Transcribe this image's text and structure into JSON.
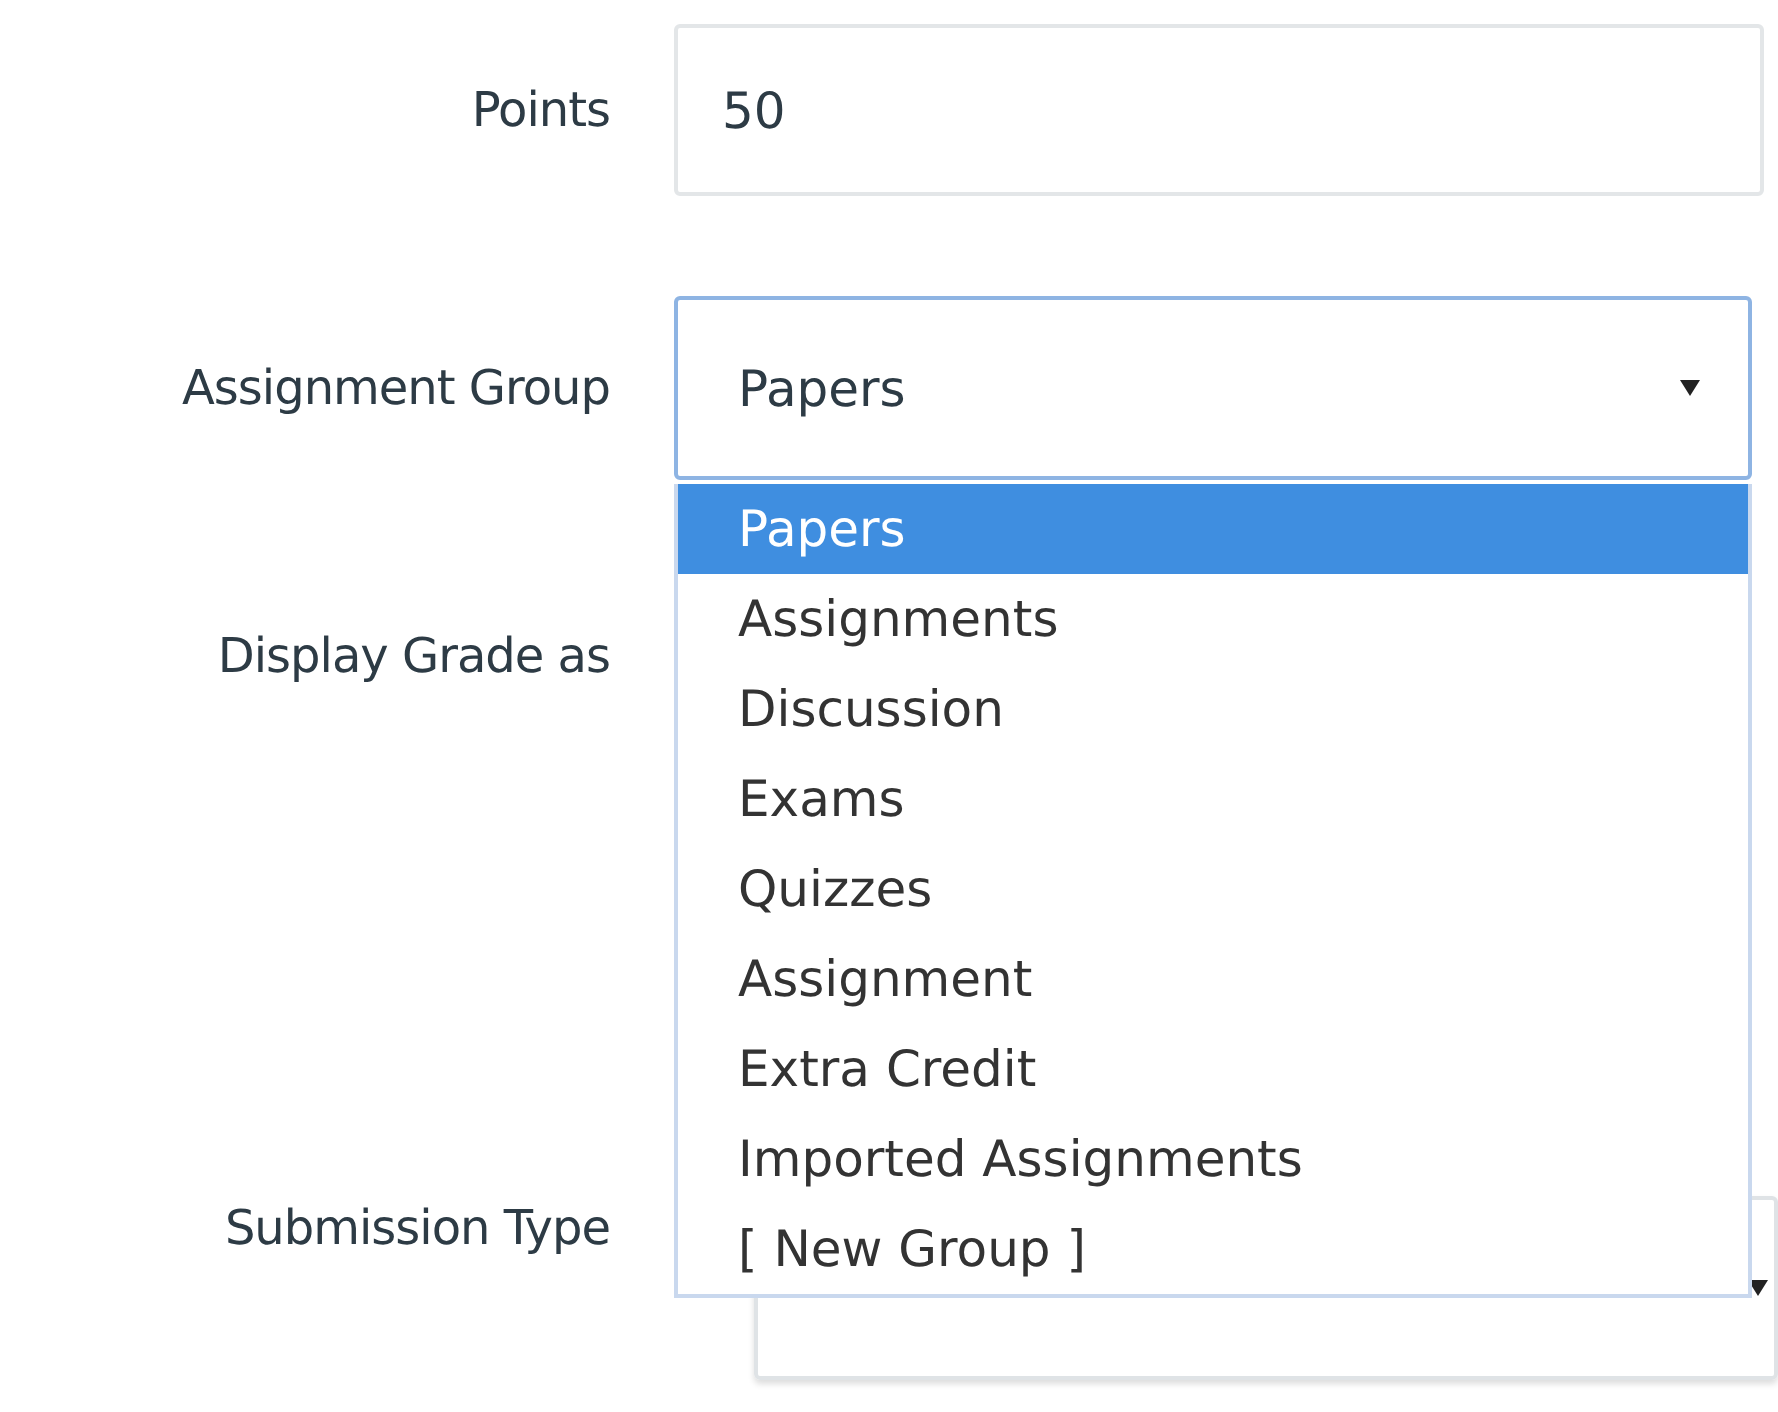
{
  "fields": [
    {
      "label": "Points",
      "kind": "input",
      "value": "50"
    },
    {
      "label": "Assignment Group",
      "kind": "select",
      "value": "Papers",
      "expanded": true,
      "options": [
        {
          "label": "Papers",
          "selected": true
        },
        {
          "label": "Assignments",
          "selected": false
        },
        {
          "label": "Discussion",
          "selected": false
        },
        {
          "label": "Exams",
          "selected": false
        },
        {
          "label": "Quizzes",
          "selected": false
        },
        {
          "label": "Assignment",
          "selected": false
        },
        {
          "label": "Extra Credit",
          "selected": false
        },
        {
          "label": "Imported Assignments",
          "selected": false
        },
        {
          "label": "[ New Group ]",
          "selected": false
        }
      ]
    },
    {
      "label": "Display Grade as",
      "kind": "covered"
    },
    {
      "label": "Submission Type",
      "kind": "select",
      "expanded": false
    }
  ]
}
